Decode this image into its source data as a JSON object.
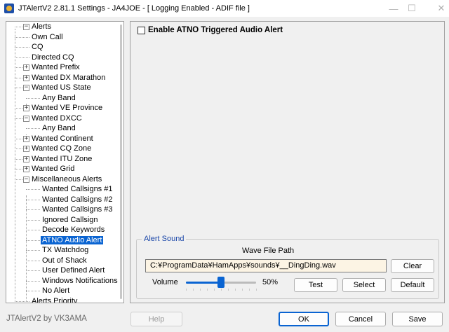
{
  "window": {
    "title": "JTAlertV2  2.81.1 Settings  -  JA4JOE  -  [ Logging Enabled - ADIF file ]",
    "min": "—",
    "max": "☐",
    "close": "✕"
  },
  "tree": {
    "items": [
      {
        "label": "Alerts",
        "expander": "−"
      },
      {
        "label": "Own Call"
      },
      {
        "label": "CQ"
      },
      {
        "label": "Directed CQ"
      },
      {
        "label": "Wanted Prefix",
        "expander": "+"
      },
      {
        "label": "Wanted DX Marathon",
        "expander": "+"
      },
      {
        "label": "Wanted US State",
        "expander": "−"
      },
      {
        "label": "Any Band"
      },
      {
        "label": "Wanted VE Province",
        "expander": "+"
      },
      {
        "label": "Wanted DXCC",
        "expander": "−"
      },
      {
        "label": "Any Band"
      },
      {
        "label": "Wanted Continent",
        "expander": "+"
      },
      {
        "label": "Wanted CQ Zone",
        "expander": "+"
      },
      {
        "label": "Wanted ITU Zone",
        "expander": "+"
      },
      {
        "label": "Wanted Grid",
        "expander": "+"
      },
      {
        "label": "Miscellaneous Alerts",
        "expander": "−"
      },
      {
        "label": "Wanted Callsigns #1"
      },
      {
        "label": "Wanted Callsigns #2"
      },
      {
        "label": "Wanted Callsigns #3"
      },
      {
        "label": "Ignored Callsign"
      },
      {
        "label": "Decode Keywords"
      },
      {
        "label": "ATNO Audio Alert",
        "selected": true
      },
      {
        "label": "TX Watchdog"
      },
      {
        "label": "Out of Shack"
      },
      {
        "label": "User Defined Alert"
      },
      {
        "label": "Windows Notifications"
      },
      {
        "label": "No Alert"
      },
      {
        "label": "Alerts Priority"
      }
    ]
  },
  "main": {
    "enable_label": "Enable ATNO Triggered Audio Alert",
    "enable_checked": false,
    "alert_sound": {
      "group_title": "Alert Sound",
      "wave_label": "Wave File Path",
      "path": "C:¥ProgramData¥HamApps¥sounds¥__DingDing.wav",
      "clear_label": "Clear",
      "volume_label": "Volume",
      "volume_value": "50%",
      "volume_fraction": 0.5,
      "test_label": "Test",
      "select_label": "Select",
      "default_label": "Default"
    }
  },
  "footer": {
    "credit": "JTAlertV2 by VK3AMA",
    "help_label": "Help",
    "ok_label": "OK",
    "cancel_label": "Cancel",
    "save_label": "Save"
  },
  "colors": {
    "accent": "#0a64d2",
    "group_title": "#1a46a8",
    "path_bg": "#fcf4e4"
  }
}
